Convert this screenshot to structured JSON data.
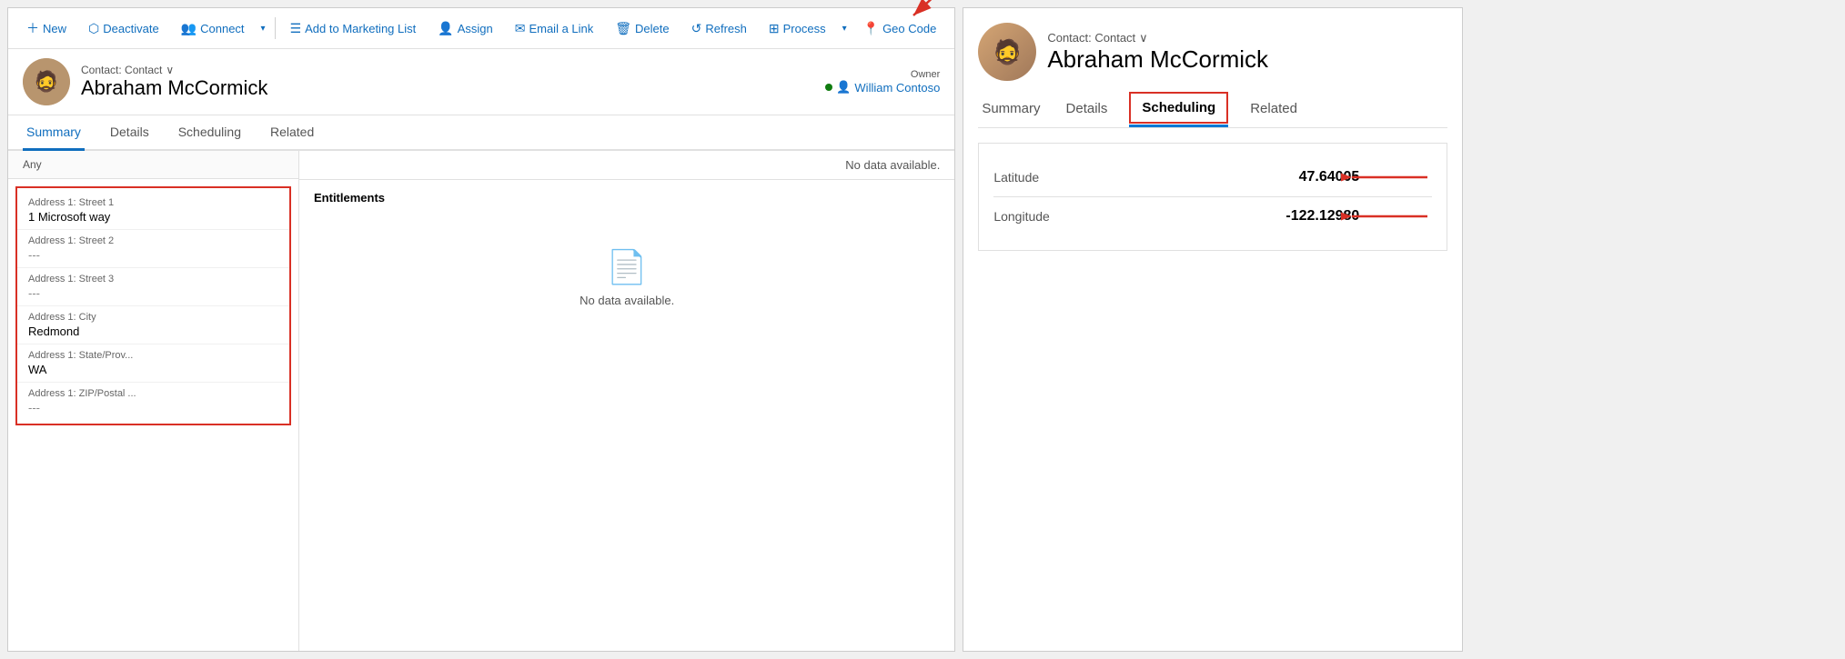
{
  "toolbar": {
    "new_label": "New",
    "deactivate_label": "Deactivate",
    "connect_label": "Connect",
    "marketing_label": "Add to Marketing List",
    "assign_label": "Assign",
    "email_label": "Email a Link",
    "delete_label": "Delete",
    "refresh_label": "Refresh",
    "process_label": "Process",
    "geocode_label": "Geo Code"
  },
  "contact": {
    "type": "Contact: Contact",
    "name": "Abraham McCormick",
    "owner_label": "Owner",
    "owner_name": "William Contoso"
  },
  "tabs": {
    "summary": "Summary",
    "details": "Details",
    "scheduling": "Scheduling",
    "related": "Related"
  },
  "address": {
    "section_label": "Any",
    "street1_label": "Address 1: Street 1",
    "street1_value": "1 Microsoft way",
    "street2_label": "Address 1: Street 2",
    "street2_value": "---",
    "street3_label": "Address 1: Street 3",
    "street3_value": "---",
    "city_label": "Address 1: City",
    "city_value": "Redmond",
    "state_label": "Address 1: State/Prov...",
    "state_value": "WA",
    "zip_label": "Address 1: ZIP/Postal ...",
    "zip_value": "---"
  },
  "entitlements": {
    "title": "Entitlements",
    "no_data": "No data available."
  },
  "no_data_top": "No data available.",
  "right_panel": {
    "contact_type": "Contact: Contact",
    "contact_name": "Abraham McCormick",
    "tab_summary": "Summary",
    "tab_details": "Details",
    "tab_scheduling": "Scheduling",
    "tab_related": "Related",
    "latitude_label": "Latitude",
    "latitude_value": "47.64005",
    "longitude_label": "Longitude",
    "longitude_value": "-122.12980"
  }
}
